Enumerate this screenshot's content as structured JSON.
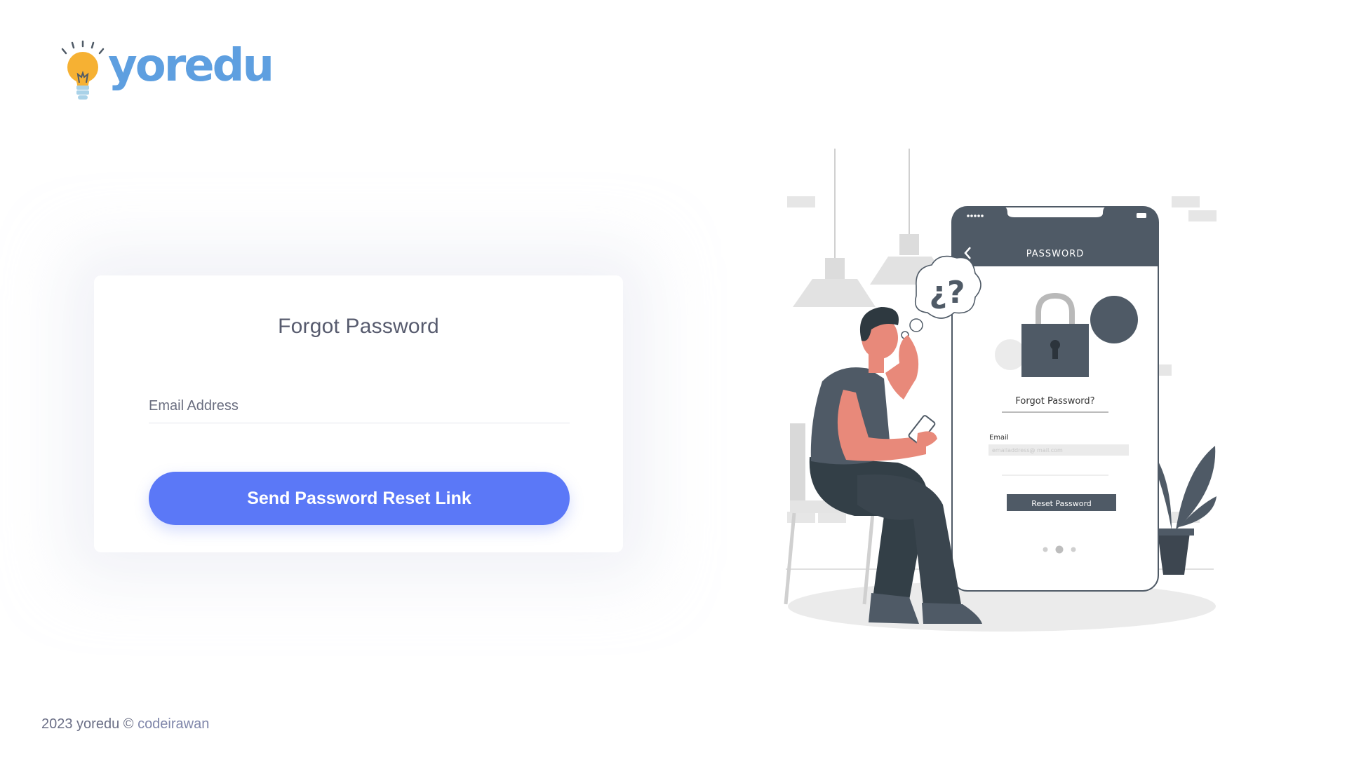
{
  "brand": {
    "name": "yoredu"
  },
  "card": {
    "title": "Forgot Password",
    "email_placeholder": "Email Address",
    "email_value": "",
    "submit_label": "Send Password Reset Link"
  },
  "footer": {
    "prefix": "2023 yoredu © ",
    "author": "codeirawan"
  },
  "illustration": {
    "header": "PASSWORD",
    "question": "Forgot Password?",
    "email_label": "Email",
    "email_placeholder": "emailaddress@ mail.com",
    "button_label": "Reset Password",
    "bubble_text": "¿?"
  },
  "colors": {
    "accent": "#5b78f7",
    "brand_blue": "#5e9fe0",
    "bulb": "#f6b133",
    "phone_header": "#4f5a66",
    "skin": "#e8897a"
  }
}
